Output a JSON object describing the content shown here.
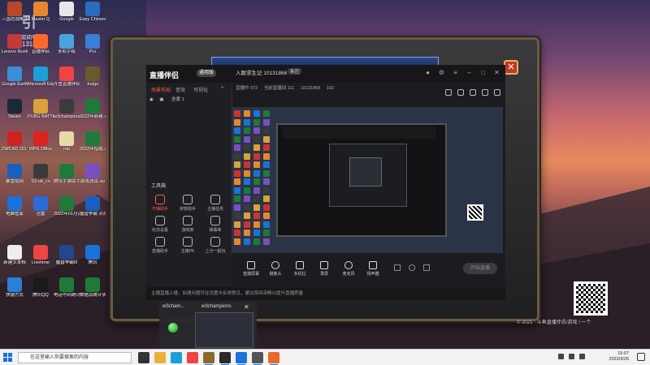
{
  "desktop": {
    "profile": {
      "name": "房间号",
      "id": "10131868"
    },
    "icons": [
      {
        "label": "三国志战略版",
        "color": "#b8482a"
      },
      {
        "label": "Master Q",
        "color": "#e6872d"
      },
      {
        "label": "Google",
        "color": "#e8e8e8"
      },
      {
        "label": "Easy Chinese",
        "color": "#2a6cc0"
      },
      {
        "label": "Lenovo Runtime",
        "color": "#c23a3a"
      },
      {
        "label": "直播伴侣",
        "color": "#ff6a2a"
      },
      {
        "label": "多彩手绘",
        "color": "#4aa3df"
      },
      {
        "label": "Pro",
        "color": "#3a7fd6"
      },
      {
        "label": "Google Earth Pro",
        "color": "#3a8fd6"
      },
      {
        "label": "Microsoft Edge",
        "color": "#1aa0d8"
      },
      {
        "label": "斗鱼直播伴侣",
        "color": "#e44"
      },
      {
        "label": "Judge",
        "color": "#6a5a2a"
      },
      {
        "label": "Steam",
        "color": "#1b2838"
      },
      {
        "label": "PUBG BATTLEGR...",
        "color": "#d9a23a"
      },
      {
        "label": "w3champions",
        "color": "#3b3b3b"
      },
      {
        "label": "2022年新建.xlsx",
        "color": "#1f7a3a"
      },
      {
        "label": "ZWCAD 2017",
        "color": "#c22"
      },
      {
        "label": "WPS Office",
        "color": "#d22"
      },
      {
        "label": "rep",
        "color": "#e8d9a8"
      },
      {
        "label": "2022年招聘.xlsx",
        "color": "#1f7a3a"
      },
      {
        "label": "暴雪战网",
        "color": "#1a5fbf"
      },
      {
        "label": "S3-ob_cn",
        "color": "#3a3a3a"
      },
      {
        "label": "腾讯手游助手",
        "color": "#1f7a3a"
      },
      {
        "label": "游戏测试.zip",
        "color": "#7a4fbf"
      },
      {
        "label": "电脑管家",
        "color": "#1a73d9"
      },
      {
        "label": "迅雷",
        "color": "#2a6ad9"
      },
      {
        "label": "2022年01月计划.xlsx",
        "color": "#1f7a3a"
      },
      {
        "label": "魔兽争霸 对战平台",
        "color": "#1a5fbf"
      },
      {
        "label": "新建文本档",
        "color": "#eee"
      },
      {
        "label": "Livehime",
        "color": "#e44"
      },
      {
        "label": "魔兽争霸III",
        "color": "#23478a"
      },
      {
        "label": "腾讯",
        "color": "#1a73d9"
      },
      {
        "label": "快捷方式",
        "color": "#2a7fd6"
      },
      {
        "label": "腾讯QQ",
        "color": "#1a1a1a"
      },
      {
        "label": "电话号码统计.xlsx",
        "color": "#1f7a3a"
      },
      {
        "label": "数据及统计表.xlsx",
        "color": "#1f7a3a"
      }
    ]
  },
  "app": {
    "title": "直播伴侣",
    "badge": "通用版",
    "room_name": "入眼求生记 10131868",
    "room_tag": "集团",
    "left_tabs": [
      "场景布局",
      "音效",
      "可视化",
      "+"
    ],
    "scene_label": "全景 1",
    "toolbox_title": "工具箱",
    "tools": [
      {
        "label": "开播助手",
        "active": true
      },
      {
        "label": "房管助手"
      },
      {
        "label": "主播任务"
      },
      {
        "label": "玩法设置"
      },
      {
        "label": "游戏库"
      },
      {
        "label": "弹幕库"
      },
      {
        "label": "直播助手"
      },
      {
        "label": "主播PK"
      },
      {
        "label": "上分一起玩"
      }
    ],
    "stream_info": [
      "直播中 972",
      "当前直播间 111",
      "10131868",
      "192"
    ],
    "controls": [
      "直播屏幕",
      "摄像头",
      "多机位",
      "录屏",
      "麦克风",
      "扬声器"
    ],
    "start_button": "开始直播",
    "status_text": "主播直播上播，如遇问题可在设置中反馈意见，建议保持流畅以提升直播质量"
  },
  "taskbar_popup": {
    "items": [
      "w3cham...",
      "w3champions"
    ]
  },
  "watermark": "© 2021 · 斗鱼直播伴侣/游戏 / 一个",
  "taskbar": {
    "search_placeholder": "在这里输入你要搜索的内容",
    "time": "15:07",
    "date": "2022/3/26",
    "apps": [
      {
        "name": "task-view",
        "color": "#333"
      },
      {
        "name": "file-explorer",
        "color": "#e8b13a"
      },
      {
        "name": "edge",
        "color": "#1aa0d8"
      },
      {
        "name": "chrome",
        "color": "#e44"
      },
      {
        "name": "warcraft",
        "color": "#8a6a2a"
      },
      {
        "name": "window",
        "color": "#2a2a2a"
      },
      {
        "name": "browser",
        "color": "#1a73d9"
      },
      {
        "name": "livehime",
        "color": "#555"
      },
      {
        "name": "stream-app",
        "color": "#e86a2a"
      }
    ]
  }
}
